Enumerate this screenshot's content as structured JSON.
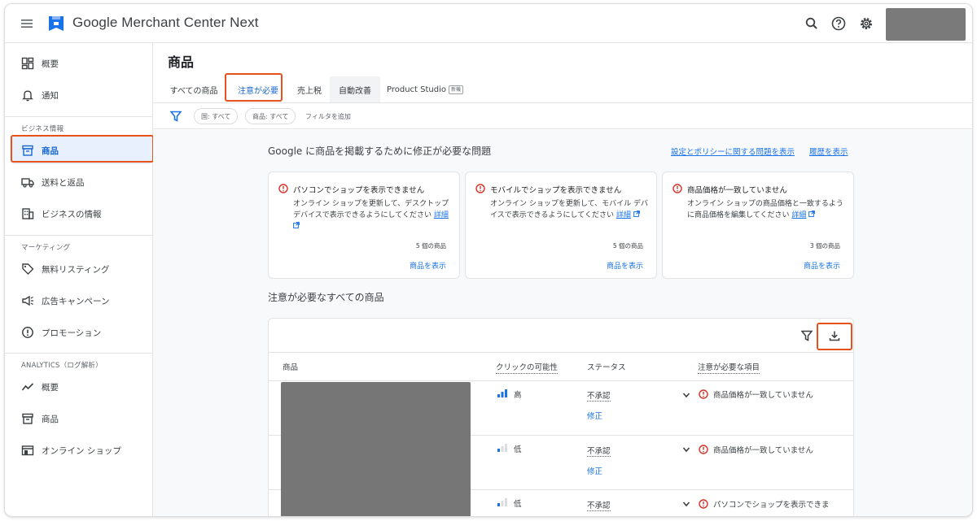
{
  "header": {
    "app_title": "Google Merchant Center Next",
    "icons": [
      "menu-icon",
      "merchant-logo-icon",
      "search-icon",
      "help-icon",
      "settings-icon"
    ]
  },
  "sidebar": {
    "items_top": [
      {
        "label": "概要",
        "icon": "dashboard-icon"
      },
      {
        "label": "通知",
        "icon": "bell-icon"
      }
    ],
    "section_business": "ビジネス情報",
    "items_business": [
      {
        "label": "商品",
        "icon": "product-box-icon",
        "active": true
      },
      {
        "label": "送料と返品",
        "icon": "truck-icon"
      },
      {
        "label": "ビジネスの情報",
        "icon": "building-icon"
      }
    ],
    "section_marketing": "マーケティング",
    "items_marketing": [
      {
        "label": "無料リスティング",
        "icon": "tag-icon"
      },
      {
        "label": "広告キャンペーン",
        "icon": "megaphone-icon"
      },
      {
        "label": "プロモーション",
        "icon": "promotion-icon"
      }
    ],
    "section_analytics": "ANALYTICS（ログ解析）",
    "items_analytics": [
      {
        "label": "概要",
        "icon": "trend-icon"
      },
      {
        "label": "商品",
        "icon": "archive-icon"
      },
      {
        "label": "オンライン ショップ",
        "icon": "store-icon"
      }
    ]
  },
  "main": {
    "page_title": "商品",
    "tabs": [
      {
        "label": "すべての商品"
      },
      {
        "label": "注意が必要",
        "selected": true
      },
      {
        "label": "売上税"
      },
      {
        "label": "自動改善"
      },
      {
        "label": "Product Studio",
        "badge": "新機"
      }
    ],
    "filters": {
      "chips": [
        "国: すべて",
        "商品: すべて"
      ],
      "add_filter": "フィルタを追加"
    },
    "issues_section": {
      "title": "Google に商品を掲載するために修正が必要な問題",
      "link_policy": "設定とポリシーに関する問題を表示",
      "link_history": "履歴を表示"
    },
    "cards": [
      {
        "title": "パソコンでショップを表示できません",
        "desc": "オンライン ショップを更新して、デスクトップ デバイスで表示できるようにしてください",
        "detail_link": "詳細",
        "count": "5 個の商品",
        "view_link": "商品を表示"
      },
      {
        "title": "モバイルでショップを表示できません",
        "desc": "オンライン ショップを更新して、モバイル デバイスで表示できるようにしてください",
        "detail_link": "詳細",
        "count": "5 個の商品",
        "view_link": "商品を表示"
      },
      {
        "title": "商品価格が一致していません",
        "desc": "オンライン ショップの商品価格と一致するように商品価格を編集してください",
        "detail_link": "詳細",
        "count": "3 個の商品",
        "view_link": "商品を表示"
      }
    ],
    "all_products_title": "注意が必要なすべての商品",
    "table": {
      "headers": {
        "product": "商品",
        "click_potential": "クリックの可能性",
        "status": "ステータス",
        "attention": "注意が必要な項目"
      },
      "rows": [
        {
          "click_level": "高",
          "click_fill": 3,
          "status": "不承認",
          "fix": "修正",
          "issue": "商品価格が一致していません"
        },
        {
          "click_level": "低",
          "click_fill": 1,
          "status": "不承認",
          "fix": "修正",
          "issue": "商品価格が一致していません"
        },
        {
          "click_level": "低",
          "click_fill": 1,
          "status": "不承認",
          "fix": "",
          "issue": "パソコンでショップを表示できま"
        }
      ]
    }
  },
  "colors": {
    "accent": "#1a73e8",
    "active_nav_bg": "#e8f0fe",
    "highlight": "#e8501c",
    "error": "#d93025"
  }
}
